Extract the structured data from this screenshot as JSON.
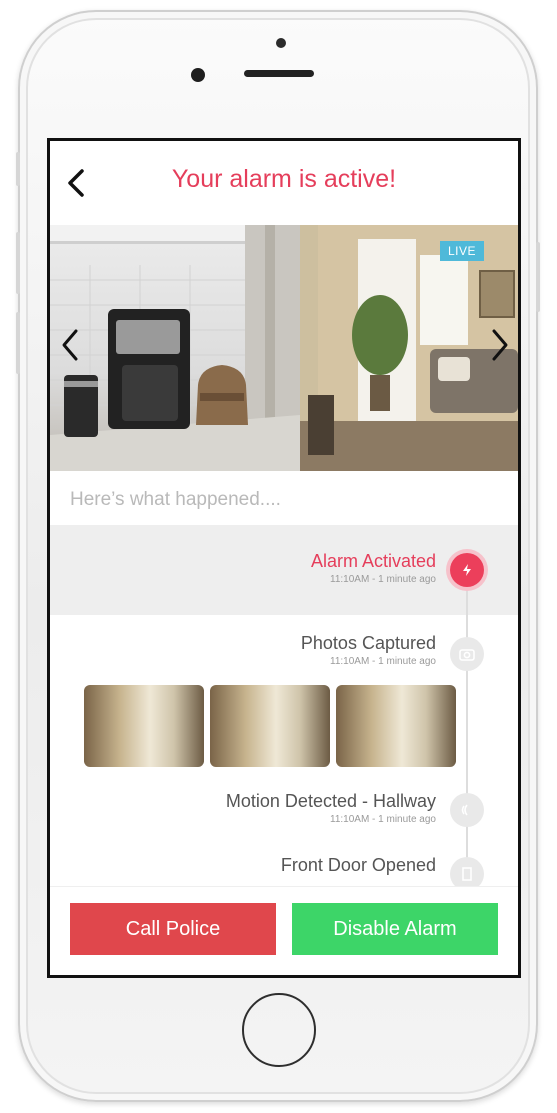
{
  "header": {
    "title": "Your alarm is active!"
  },
  "camera": {
    "live_badge": "LIVE"
  },
  "timeline": {
    "heading": "Here’s what happened....",
    "events": [
      {
        "name": "Alarm Activated",
        "time": "11:10AM - 1 minute ago",
        "icon": "alarm-icon",
        "active": true
      },
      {
        "name": "Photos Captured",
        "time": "11:10AM - 1 minute ago",
        "icon": "camera-icon",
        "active": false
      },
      {
        "name": "Motion Detected - Hallway",
        "time": "11:10AM - 1 minute ago",
        "icon": "motion-icon",
        "active": false
      },
      {
        "name": "Front Door Opened",
        "time": "",
        "icon": "door-icon",
        "active": false
      }
    ]
  },
  "actions": {
    "call_police": "Call Police",
    "disable_alarm": "Disable Alarm"
  },
  "colors": {
    "accent": "#e53e5b",
    "danger_button": "#e0474c",
    "success_button": "#3dd568",
    "live": "#4fb9d9"
  }
}
